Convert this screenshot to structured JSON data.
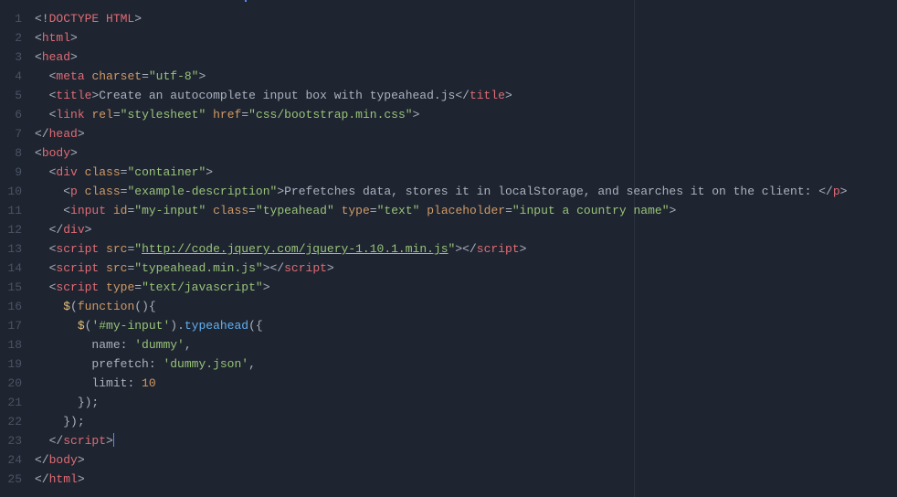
{
  "editor": {
    "line_numbers": [
      "1",
      "2",
      "3",
      "4",
      "5",
      "6",
      "7",
      "8",
      "9",
      "10",
      "11",
      "12",
      "13",
      "14",
      "15",
      "16",
      "17",
      "18",
      "19",
      "20",
      "21",
      "22",
      "23",
      "24",
      "25"
    ],
    "code_lines": [
      {
        "indent": 0,
        "tokens": [
          {
            "c": "t-bracket",
            "t": "<!"
          },
          {
            "c": "t-doctype",
            "t": "DOCTYPE HTML"
          },
          {
            "c": "t-bracket",
            "t": ">"
          }
        ]
      },
      {
        "indent": 0,
        "tokens": [
          {
            "c": "t-bracket",
            "t": "<"
          },
          {
            "c": "t-tag",
            "t": "html"
          },
          {
            "c": "t-bracket",
            "t": ">"
          }
        ]
      },
      {
        "indent": 0,
        "tokens": [
          {
            "c": "t-bracket",
            "t": "<"
          },
          {
            "c": "t-tag",
            "t": "head"
          },
          {
            "c": "t-bracket",
            "t": ">"
          }
        ]
      },
      {
        "indent": 1,
        "tokens": [
          {
            "c": "t-bracket",
            "t": "<"
          },
          {
            "c": "t-tag",
            "t": "meta"
          },
          {
            "c": "t-text",
            "t": " "
          },
          {
            "c": "t-attr",
            "t": "charset"
          },
          {
            "c": "t-eq",
            "t": "="
          },
          {
            "c": "t-string",
            "t": "\"utf-8\""
          },
          {
            "c": "t-bracket",
            "t": ">"
          }
        ]
      },
      {
        "indent": 1,
        "tokens": [
          {
            "c": "t-bracket",
            "t": "<"
          },
          {
            "c": "t-tag",
            "t": "title"
          },
          {
            "c": "t-bracket",
            "t": ">"
          },
          {
            "c": "t-text",
            "t": "Create an autocomplete input box with typeahead.js"
          },
          {
            "c": "t-bracket",
            "t": "</"
          },
          {
            "c": "t-tag",
            "t": "title"
          },
          {
            "c": "t-bracket",
            "t": ">"
          }
        ]
      },
      {
        "indent": 1,
        "tokens": [
          {
            "c": "t-bracket",
            "t": "<"
          },
          {
            "c": "t-tag",
            "t": "link"
          },
          {
            "c": "t-text",
            "t": " "
          },
          {
            "c": "t-attr",
            "t": "rel"
          },
          {
            "c": "t-eq",
            "t": "="
          },
          {
            "c": "t-string",
            "t": "\"stylesheet\""
          },
          {
            "c": "t-text",
            "t": " "
          },
          {
            "c": "t-attr",
            "t": "href"
          },
          {
            "c": "t-eq",
            "t": "="
          },
          {
            "c": "t-string",
            "t": "\"css/bootstrap.min.css\""
          },
          {
            "c": "t-bracket",
            "t": ">"
          }
        ]
      },
      {
        "indent": 0,
        "tokens": [
          {
            "c": "t-bracket",
            "t": "</"
          },
          {
            "c": "t-tag",
            "t": "head"
          },
          {
            "c": "t-bracket",
            "t": ">"
          }
        ]
      },
      {
        "indent": 0,
        "tokens": [
          {
            "c": "t-bracket",
            "t": "<"
          },
          {
            "c": "t-tag",
            "t": "body"
          },
          {
            "c": "t-bracket",
            "t": ">"
          }
        ]
      },
      {
        "indent": 1,
        "tokens": [
          {
            "c": "t-bracket",
            "t": "<"
          },
          {
            "c": "t-tag",
            "t": "div"
          },
          {
            "c": "t-text",
            "t": " "
          },
          {
            "c": "t-attr",
            "t": "class"
          },
          {
            "c": "t-eq",
            "t": "="
          },
          {
            "c": "t-string",
            "t": "\"container\""
          },
          {
            "c": "t-bracket",
            "t": ">"
          }
        ]
      },
      {
        "indent": 2,
        "tokens": [
          {
            "c": "t-bracket",
            "t": "<"
          },
          {
            "c": "t-tag",
            "t": "p"
          },
          {
            "c": "t-text",
            "t": " "
          },
          {
            "c": "t-attr",
            "t": "class"
          },
          {
            "c": "t-eq",
            "t": "="
          },
          {
            "c": "t-string",
            "t": "\"example-description\""
          },
          {
            "c": "t-bracket",
            "t": ">"
          },
          {
            "c": "t-text",
            "t": "Prefetches data, stores it in localStorage, and searches it on the client: "
          },
          {
            "c": "t-bracket",
            "t": "</"
          },
          {
            "c": "t-tag",
            "t": "p"
          },
          {
            "c": "t-bracket",
            "t": ">"
          }
        ]
      },
      {
        "indent": 2,
        "tokens": [
          {
            "c": "t-bracket",
            "t": "<"
          },
          {
            "c": "t-tag",
            "t": "input"
          },
          {
            "c": "t-text",
            "t": " "
          },
          {
            "c": "t-attr",
            "t": "id"
          },
          {
            "c": "t-eq",
            "t": "="
          },
          {
            "c": "t-string",
            "t": "\"my-input\""
          },
          {
            "c": "t-text",
            "t": " "
          },
          {
            "c": "t-attr",
            "t": "class"
          },
          {
            "c": "t-eq",
            "t": "="
          },
          {
            "c": "t-string",
            "t": "\"typeahead\""
          },
          {
            "c": "t-text",
            "t": " "
          },
          {
            "c": "t-attr",
            "t": "type"
          },
          {
            "c": "t-eq",
            "t": "="
          },
          {
            "c": "t-string",
            "t": "\"text\""
          },
          {
            "c": "t-text",
            "t": " "
          },
          {
            "c": "t-attr",
            "t": "placeholder"
          },
          {
            "c": "t-eq",
            "t": "="
          },
          {
            "c": "t-string",
            "t": "\"input a country name\""
          },
          {
            "c": "t-bracket",
            "t": ">"
          }
        ]
      },
      {
        "indent": 1,
        "tokens": [
          {
            "c": "t-bracket",
            "t": "</"
          },
          {
            "c": "t-tag",
            "t": "div"
          },
          {
            "c": "t-bracket",
            "t": ">"
          }
        ]
      },
      {
        "indent": 1,
        "tokens": [
          {
            "c": "t-bracket",
            "t": "<"
          },
          {
            "c": "t-tag",
            "t": "script"
          },
          {
            "c": "t-text",
            "t": " "
          },
          {
            "c": "t-attr",
            "t": "src"
          },
          {
            "c": "t-eq",
            "t": "="
          },
          {
            "c": "t-string",
            "t": "\""
          },
          {
            "c": "t-underline",
            "t": "http://code.jquery.com/jquery-1.10.1.min.js"
          },
          {
            "c": "t-string",
            "t": "\""
          },
          {
            "c": "t-bracket",
            "t": "></"
          },
          {
            "c": "t-tag",
            "t": "script"
          },
          {
            "c": "t-bracket",
            "t": ">"
          }
        ]
      },
      {
        "indent": 1,
        "tokens": [
          {
            "c": "t-bracket",
            "t": "<"
          },
          {
            "c": "t-tag",
            "t": "script"
          },
          {
            "c": "t-text",
            "t": " "
          },
          {
            "c": "t-attr",
            "t": "src"
          },
          {
            "c": "t-eq",
            "t": "="
          },
          {
            "c": "t-string",
            "t": "\"typeahead.min.js\""
          },
          {
            "c": "t-bracket",
            "t": "></"
          },
          {
            "c": "t-tag",
            "t": "script"
          },
          {
            "c": "t-bracket",
            "t": ">"
          }
        ]
      },
      {
        "indent": 1,
        "tokens": [
          {
            "c": "t-bracket",
            "t": "<"
          },
          {
            "c": "t-tag",
            "t": "script"
          },
          {
            "c": "t-text",
            "t": " "
          },
          {
            "c": "t-attr",
            "t": "type"
          },
          {
            "c": "t-eq",
            "t": "="
          },
          {
            "c": "t-string",
            "t": "\"text/javascript\""
          },
          {
            "c": "t-bracket",
            "t": ">"
          }
        ]
      },
      {
        "indent": 2,
        "tokens": [
          {
            "c": "t-jq",
            "t": "$"
          },
          {
            "c": "t-text",
            "t": "("
          },
          {
            "c": "t-attr",
            "t": "function"
          },
          {
            "c": "t-text",
            "t": "(){"
          }
        ]
      },
      {
        "indent": 3,
        "tokens": [
          {
            "c": "t-jq",
            "t": "$"
          },
          {
            "c": "t-text",
            "t": "("
          },
          {
            "c": "t-string",
            "t": "'#my-input'"
          },
          {
            "c": "t-text",
            "t": ")."
          },
          {
            "c": "t-call",
            "t": "typeahead"
          },
          {
            "c": "t-text",
            "t": "({"
          }
        ]
      },
      {
        "indent": 4,
        "tokens": [
          {
            "c": "t-jskey",
            "t": "name"
          },
          {
            "c": "t-text",
            "t": ": "
          },
          {
            "c": "t-string",
            "t": "'dummy'"
          },
          {
            "c": "t-text",
            "t": ","
          }
        ]
      },
      {
        "indent": 4,
        "tokens": [
          {
            "c": "t-jskey",
            "t": "prefetch"
          },
          {
            "c": "t-text",
            "t": ": "
          },
          {
            "c": "t-string",
            "t": "'dummy.json'"
          },
          {
            "c": "t-text",
            "t": ","
          }
        ]
      },
      {
        "indent": 4,
        "tokens": [
          {
            "c": "t-jskey",
            "t": "limit"
          },
          {
            "c": "t-text",
            "t": ": "
          },
          {
            "c": "t-num",
            "t": "10"
          }
        ]
      },
      {
        "indent": 3,
        "tokens": [
          {
            "c": "t-text",
            "t": "});"
          }
        ]
      },
      {
        "indent": 2,
        "tokens": [
          {
            "c": "t-text",
            "t": "});"
          }
        ]
      },
      {
        "indent": 1,
        "tokens": [
          {
            "c": "t-bracket",
            "t": "</"
          },
          {
            "c": "t-tag",
            "t": "script"
          },
          {
            "c": "t-bracket",
            "t": ">"
          }
        ],
        "cursor": true
      },
      {
        "indent": 0,
        "tokens": [
          {
            "c": "t-bracket",
            "t": "</"
          },
          {
            "c": "t-tag",
            "t": "body"
          },
          {
            "c": "t-bracket",
            "t": ">"
          }
        ]
      },
      {
        "indent": 0,
        "tokens": [
          {
            "c": "t-bracket",
            "t": "</"
          },
          {
            "c": "t-tag",
            "t": "html"
          },
          {
            "c": "t-bracket",
            "t": ">"
          }
        ]
      }
    ]
  }
}
